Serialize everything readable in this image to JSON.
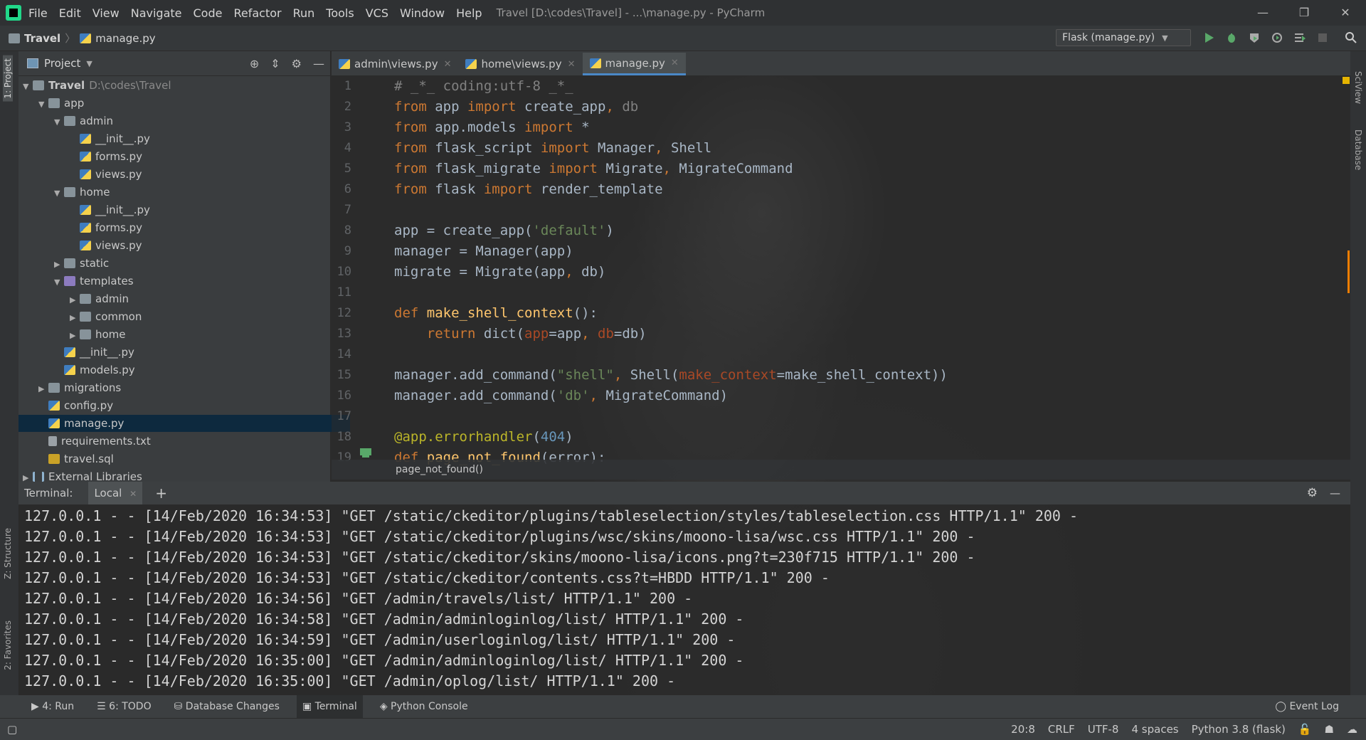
{
  "menubar": {
    "items": [
      "File",
      "Edit",
      "View",
      "Navigate",
      "Code",
      "Refactor",
      "Run",
      "Tools",
      "VCS",
      "Window",
      "Help"
    ],
    "title": "Travel [D:\\codes\\Travel] - ...\\manage.py - PyCharm",
    "window_buttons": [
      "—",
      "❐",
      "✕"
    ]
  },
  "navbar": {
    "project": "Travel",
    "file": "manage.py",
    "run_config": "Flask (manage.py)"
  },
  "leftstrip": {
    "project": "1: Project",
    "structure": "Z: Structure",
    "favorites": "2: Favorites"
  },
  "rightstrip": {
    "sciview": "SciView",
    "database": "Database"
  },
  "project_panel": {
    "title": "Project",
    "tree": [
      {
        "label": "Travel",
        "extra": "D:\\codes\\Travel",
        "arrow": "▼",
        "icon": "folder"
      },
      {
        "label": "app",
        "arrow": "▼",
        "icon": "folder"
      },
      {
        "label": "admin",
        "arrow": "▼",
        "icon": "folder"
      },
      {
        "label": "__init__.py",
        "arrow": "",
        "icon": "py"
      },
      {
        "label": "forms.py",
        "arrow": "",
        "icon": "py"
      },
      {
        "label": "views.py",
        "arrow": "",
        "icon": "py"
      },
      {
        "label": "home",
        "arrow": "▼",
        "icon": "folder"
      },
      {
        "label": "__init__.py",
        "arrow": "",
        "icon": "py"
      },
      {
        "label": "forms.py",
        "arrow": "",
        "icon": "py"
      },
      {
        "label": "views.py",
        "arrow": "",
        "icon": "py"
      },
      {
        "label": "static",
        "arrow": "▶",
        "icon": "folder"
      },
      {
        "label": "templates",
        "arrow": "▼",
        "icon": "folder-purple"
      },
      {
        "label": "admin",
        "arrow": "▶",
        "icon": "folder"
      },
      {
        "label": "common",
        "arrow": "▶",
        "icon": "folder"
      },
      {
        "label": "home",
        "arrow": "▶",
        "icon": "folder"
      },
      {
        "label": "__init__.py",
        "arrow": "",
        "icon": "py"
      },
      {
        "label": "models.py",
        "arrow": "",
        "icon": "py"
      },
      {
        "label": "migrations",
        "arrow": "▶",
        "icon": "folder"
      },
      {
        "label": "config.py",
        "arrow": "",
        "icon": "py"
      },
      {
        "label": "manage.py",
        "arrow": "",
        "icon": "py"
      },
      {
        "label": "requirements.txt",
        "arrow": "",
        "icon": "txt"
      },
      {
        "label": "travel.sql",
        "arrow": "",
        "icon": "sql"
      },
      {
        "label": "External Libraries",
        "arrow": "▶",
        "icon": "lib"
      }
    ]
  },
  "tabs": [
    {
      "label": "admin\\views.py"
    },
    {
      "label": "home\\views.py"
    },
    {
      "label": "manage.py"
    }
  ],
  "editor": {
    "line_numbers": [
      "1",
      "2",
      "3",
      "4",
      "5",
      "6",
      "7",
      "8",
      "9",
      "10",
      "11",
      "12",
      "13",
      "14",
      "15",
      "16",
      "17",
      "18",
      "19"
    ],
    "lines": [
      [
        {
          "t": "# _*_ coding:utf-8 _*_",
          "c": "com"
        }
      ],
      [
        {
          "t": "from",
          "c": "kw"
        },
        {
          "t": " app ",
          "c": ""
        },
        {
          "t": "import",
          "c": "kw"
        },
        {
          "t": " create_app",
          "c": ""
        },
        {
          "t": ", ",
          "c": "kw"
        },
        {
          "t": "db",
          "c": "gry"
        }
      ],
      [
        {
          "t": "from",
          "c": "kw"
        },
        {
          "t": " app.models ",
          "c": ""
        },
        {
          "t": "import",
          "c": "kw"
        },
        {
          "t": " *",
          "c": ""
        }
      ],
      [
        {
          "t": "from",
          "c": "kw"
        },
        {
          "t": " flask_script ",
          "c": ""
        },
        {
          "t": "import",
          "c": "kw"
        },
        {
          "t": " Manager",
          "c": ""
        },
        {
          "t": ", ",
          "c": "kw"
        },
        {
          "t": "Shell",
          "c": ""
        }
      ],
      [
        {
          "t": "from",
          "c": "kw"
        },
        {
          "t": " flask_migrate ",
          "c": ""
        },
        {
          "t": "import",
          "c": "kw"
        },
        {
          "t": " Migrate",
          "c": ""
        },
        {
          "t": ", ",
          "c": "kw"
        },
        {
          "t": "MigrateCommand",
          "c": ""
        }
      ],
      [
        {
          "t": "from",
          "c": "kw"
        },
        {
          "t": " flask ",
          "c": ""
        },
        {
          "t": "import",
          "c": "kw"
        },
        {
          "t": " render_template",
          "c": ""
        }
      ],
      [],
      [
        {
          "t": "app = create_app(",
          "c": ""
        },
        {
          "t": "'default'",
          "c": "str"
        },
        {
          "t": ")",
          "c": ""
        }
      ],
      [
        {
          "t": "manager = Manager(app)",
          "c": ""
        }
      ],
      [
        {
          "t": "migrate = Migrate(app",
          "c": ""
        },
        {
          "t": ", ",
          "c": "kw"
        },
        {
          "t": "db)",
          "c": ""
        }
      ],
      [],
      [
        {
          "t": "def ",
          "c": "kw"
        },
        {
          "t": "make_shell_context",
          "c": "fn"
        },
        {
          "t": "():",
          "c": ""
        }
      ],
      [
        {
          "t": "    ",
          "c": ""
        },
        {
          "t": "return ",
          "c": "kw"
        },
        {
          "t": "dict(",
          "c": ""
        },
        {
          "t": "app",
          "c": "arg"
        },
        {
          "t": "=app",
          "c": ""
        },
        {
          "t": ", ",
          "c": "kw"
        },
        {
          "t": "db",
          "c": "arg"
        },
        {
          "t": "=db)",
          "c": ""
        }
      ],
      [],
      [
        {
          "t": "manager.add_command(",
          "c": ""
        },
        {
          "t": "\"shell\"",
          "c": "str"
        },
        {
          "t": ", ",
          "c": "kw"
        },
        {
          "t": "Shell(",
          "c": ""
        },
        {
          "t": "make_context",
          "c": "arg"
        },
        {
          "t": "=make_shell_context))",
          "c": ""
        }
      ],
      [
        {
          "t": "manager.add_command(",
          "c": ""
        },
        {
          "t": "'db'",
          "c": "str"
        },
        {
          "t": ", ",
          "c": "kw"
        },
        {
          "t": "MigrateCommand)",
          "c": ""
        }
      ],
      [],
      [
        {
          "t": "@app.errorhandler",
          "c": "dec"
        },
        {
          "t": "(",
          "c": ""
        },
        {
          "t": "404",
          "c": "num"
        },
        {
          "t": ")",
          "c": ""
        }
      ],
      [
        {
          "t": "def ",
          "c": "kw"
        },
        {
          "t": "page_not_found",
          "c": "fn"
        },
        {
          "t": "(error):",
          "c": ""
        }
      ]
    ],
    "breadcrumb": "page_not_found()"
  },
  "terminal": {
    "label": "Terminal:",
    "tab": "Local",
    "lines": [
      "127.0.0.1 - - [14/Feb/2020 16:34:53] \"GET /static/ckeditor/plugins/tableselection/styles/tableselection.css HTTP/1.1\" 200 -",
      "127.0.0.1 - - [14/Feb/2020 16:34:53] \"GET /static/ckeditor/plugins/wsc/skins/moono-lisa/wsc.css HTTP/1.1\" 200 -",
      "127.0.0.1 - - [14/Feb/2020 16:34:53] \"GET /static/ckeditor/skins/moono-lisa/icons.png?t=230f715 HTTP/1.1\" 200 -",
      "127.0.0.1 - - [14/Feb/2020 16:34:53] \"GET /static/ckeditor/contents.css?t=HBDD HTTP/1.1\" 200 -",
      "127.0.0.1 - - [14/Feb/2020 16:34:56] \"GET /admin/travels/list/ HTTP/1.1\" 200 -",
      "127.0.0.1 - - [14/Feb/2020 16:34:58] \"GET /admin/adminloginlog/list/ HTTP/1.1\" 200 -",
      "127.0.0.1 - - [14/Feb/2020 16:34:59] \"GET /admin/userloginlog/list/ HTTP/1.1\" 200 -",
      "127.0.0.1 - - [14/Feb/2020 16:35:00] \"GET /admin/adminloginlog/list/ HTTP/1.1\" 200 -",
      "127.0.0.1 - - [14/Feb/2020 16:35:00] \"GET /admin/oplog/list/ HTTP/1.1\" 200 -"
    ]
  },
  "bottombar": {
    "run": "4: Run",
    "todo": "6: TODO",
    "db_changes": "Database Changes",
    "terminal": "Terminal",
    "python_console": "Python Console",
    "event_log": "Event Log"
  },
  "statusbar": {
    "position": "20:8",
    "line_sep": "CRLF",
    "encoding": "UTF-8",
    "indent": "4 spaces",
    "interpreter": "Python 3.8 (flask)"
  },
  "colors": {
    "accent": "#4a88c7",
    "keyword": "#cc7832",
    "string": "#6a8759",
    "function": "#ffc66d",
    "run_green": "#59a869"
  }
}
